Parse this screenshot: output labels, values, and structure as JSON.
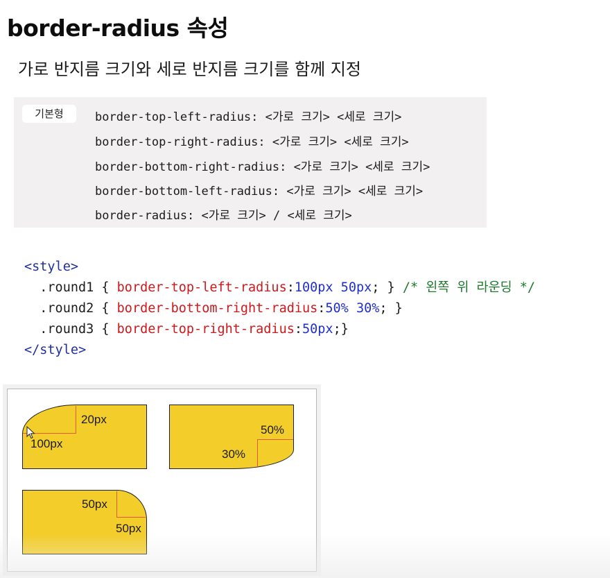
{
  "page": {
    "title": "border-radius 속성",
    "subtitle": "가로 반지름 크기와 세로 반지름 크기를 함께 지정"
  },
  "syntax": {
    "badge": "기본형",
    "lines": [
      "border-top-left-radius: <가로 크기> <세로 크기>",
      "border-top-right-radius: <가로 크기> <세로 크기>",
      "border-bottom-right-radius: <가로 크기> <세로 크기>",
      "border-bottom-left-radius: <가로 크기> <세로 크기>",
      "border-radius: <가로 크기> / <세로 크기>"
    ]
  },
  "code": {
    "open_tag": "<style>",
    "close_tag": "</style>",
    "rules": [
      {
        "selector": ".round1",
        "property": "border-top-left-radius",
        "value": "100px 50px",
        "end": "; }",
        "comment": "/* 왼쪽 위 라운딩 */"
      },
      {
        "selector": ".round2",
        "property": "border-bottom-right-radius",
        "value": "50% 30%",
        "end": "; }",
        "comment": ""
      },
      {
        "selector": ".round3",
        "property": "border-top-right-radius",
        "value": "50px",
        "end": ";}",
        "comment": ""
      }
    ]
  },
  "demo": {
    "box1": {
      "label_top": "20px",
      "label_left": "100px"
    },
    "box2": {
      "label_top": "50%",
      "label_left": "30%"
    },
    "box3": {
      "label_top": "50px",
      "label_right": "50px"
    }
  },
  "colors": {
    "shape_fill": "#f3cd2a",
    "guide_line": "#e25a3a",
    "code_tag": "#1f2f9c",
    "code_property": "#d0171b",
    "code_value": "#1f2fcc",
    "code_comment": "#1d7a2b"
  }
}
